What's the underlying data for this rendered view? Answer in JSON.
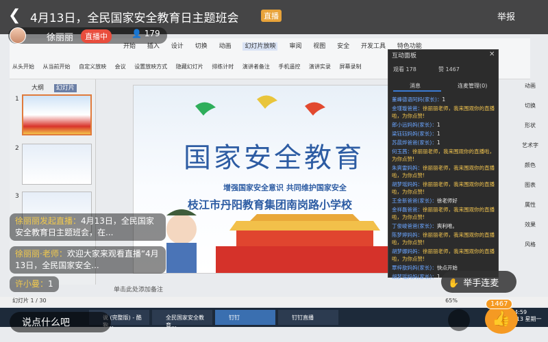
{
  "live": {
    "title": "4月13日，全民国家安全教育日主题班会",
    "live_tag": "直播",
    "report": "举报",
    "host_name": "徐丽丽",
    "live_status": "直播中",
    "viewer_count": "179"
  },
  "ppt": {
    "menu": [
      "开始",
      "插入",
      "设计",
      "切换",
      "动画",
      "幻灯片放映",
      "审阅",
      "视图",
      "安全",
      "开发工具",
      "特色功能"
    ],
    "active_menu": "幻灯片放映",
    "tools": [
      "从头开始",
      "从当前开始",
      "自定义放映",
      "会议",
      "设置放映方式",
      "隐藏幻灯片",
      "排练计时",
      "演讲者备注",
      "手机遥控",
      "演讲实录",
      "屏幕录制"
    ],
    "thumb_tabs": [
      "大纲",
      "幻灯片"
    ],
    "thumb_numbers": [
      "1",
      "2",
      "3"
    ],
    "slide": {
      "title": "国家安全教育",
      "subtitle": "增强国家安全意识  共同维护国家安全",
      "school": "枝江市丹阳教育集团南岗路小学校"
    },
    "notes_placeholder": "单击此处添加备注",
    "status_left": "幻灯片 1 / 30",
    "zoom": "65%"
  },
  "panel": {
    "title": "互动面板",
    "viewers": "观看 178",
    "likes": "赞 1467",
    "tabs": [
      "消息",
      "连麦管理(0)"
    ],
    "messages": [
      {
        "name": "董峰德语阿妈(家长)：",
        "text": "1"
      },
      {
        "name": "金瑾璇爸爸：",
        "text": "徐丽丽老师，我来围观你的直播啦，为你点赞!"
      },
      {
        "name": "郎小远妈妈(家长)：",
        "text": "1"
      },
      {
        "name": "梁钰钰妈妈(家长)：",
        "text": "1"
      },
      {
        "name": "苏晨烨爸爸(家长)：",
        "text": "1"
      },
      {
        "name": "何玉茜：",
        "text": "徐丽丽老师，我来围观你的直播啦，为你点赞!"
      },
      {
        "name": "朱爽雷妈妈：",
        "text": "徐丽丽老师，我来围观你的直播啦，为你点赞!"
      },
      {
        "name": "胡梦瑶妈妈：",
        "text": "徐丽丽老师，我来围观你的直播啦，为你点赞!"
      },
      {
        "name": "王金新爸爸(家长)：",
        "text": "徐老师好"
      },
      {
        "name": "金祥磊爸爸：",
        "text": "徐丽丽老师，我来围观你的直播啦，为你点赞!"
      },
      {
        "name": "丁俊峻爸爸(家长)：",
        "text": "爽利唯。"
      },
      {
        "name": "陈梦婷妈妈：",
        "text": "徐丽丽老师，我来围观你的直播啦，为你点赞!"
      },
      {
        "name": "胡梦娜妈妈：",
        "text": "徐丽丽老师，我来围观你的直播啦，为你点赞!"
      },
      {
        "name": "覃梓歆妈妈(家长)：",
        "text": "快点开始"
      },
      {
        "name": "胡梦瑶妈妈(家长)：",
        "text": "1"
      }
    ]
  },
  "right_tools": [
    "动画",
    "切换",
    "形状",
    "艺术字",
    "颜色",
    "图表",
    "属性",
    "效果",
    "风格"
  ],
  "comments": [
    {
      "name": "徐丽丽发起直播：",
      "text": "4月13日，全民国家安全教育日主题班会，在..."
    },
    {
      "name": "徐丽丽·老师：",
      "text": "欢迎大家来观看直播“4月13日，全民国家安全..."
    },
    {
      "name": "许小曼：",
      "text": "1"
    }
  ],
  "bottom": {
    "say": "说点什么吧",
    "raise_hand": "举手连麦",
    "like_count": "1467"
  },
  "taskbar": {
    "tasks": [
      "说 (完整版) - 酷狗...",
      "全民国家安全教育...",
      "钉钉",
      "钉钉直播"
    ],
    "time": "14:59",
    "date": "4/13 星期一"
  }
}
